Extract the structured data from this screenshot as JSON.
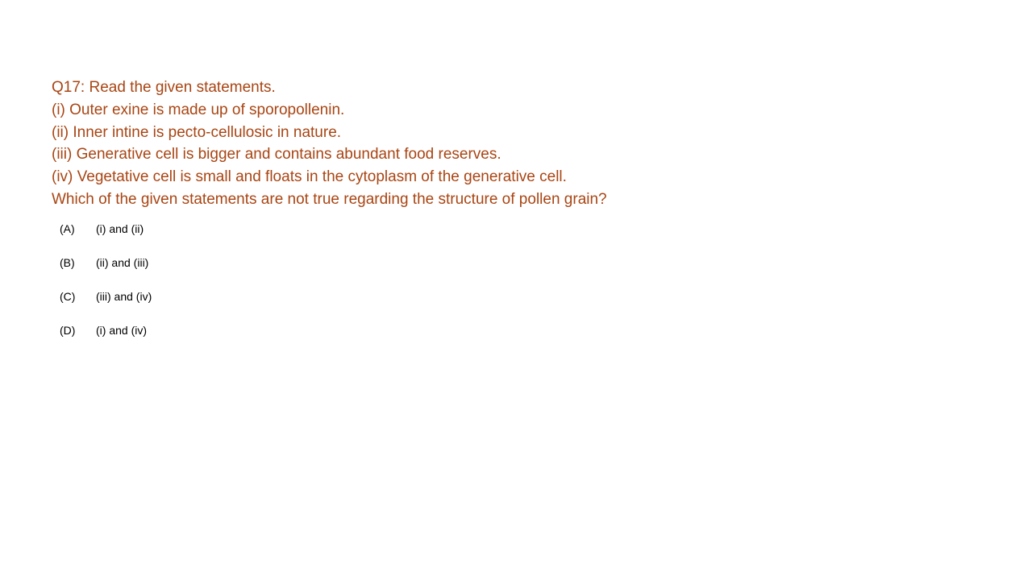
{
  "question": {
    "title": "Q17: Read the given statements.",
    "statements": [
      "(i) Outer exine is made up of sporopollenin.",
      "(ii) Inner intine is pecto-cellulosic in nature.",
      "(iii) Generative cell is bigger and contains abundant food reserves.",
      "(iv) Vegetative cell is small and floats in the cytoplasm of the generative cell."
    ],
    "prompt": "Which of the given statements are not true regarding the structure of pollen grain?"
  },
  "options": [
    {
      "letter": "(A)",
      "text": "(i) and (ii)"
    },
    {
      "letter": "(B)",
      "text": "(ii) and (iii)"
    },
    {
      "letter": "(C)",
      "text": "(iii) and (iv)"
    },
    {
      "letter": "(D)",
      "text": "(i) and (iv)"
    }
  ],
  "colors": {
    "question_text": "#a94513",
    "option_text": "#000000",
    "background": "#ffffff"
  }
}
